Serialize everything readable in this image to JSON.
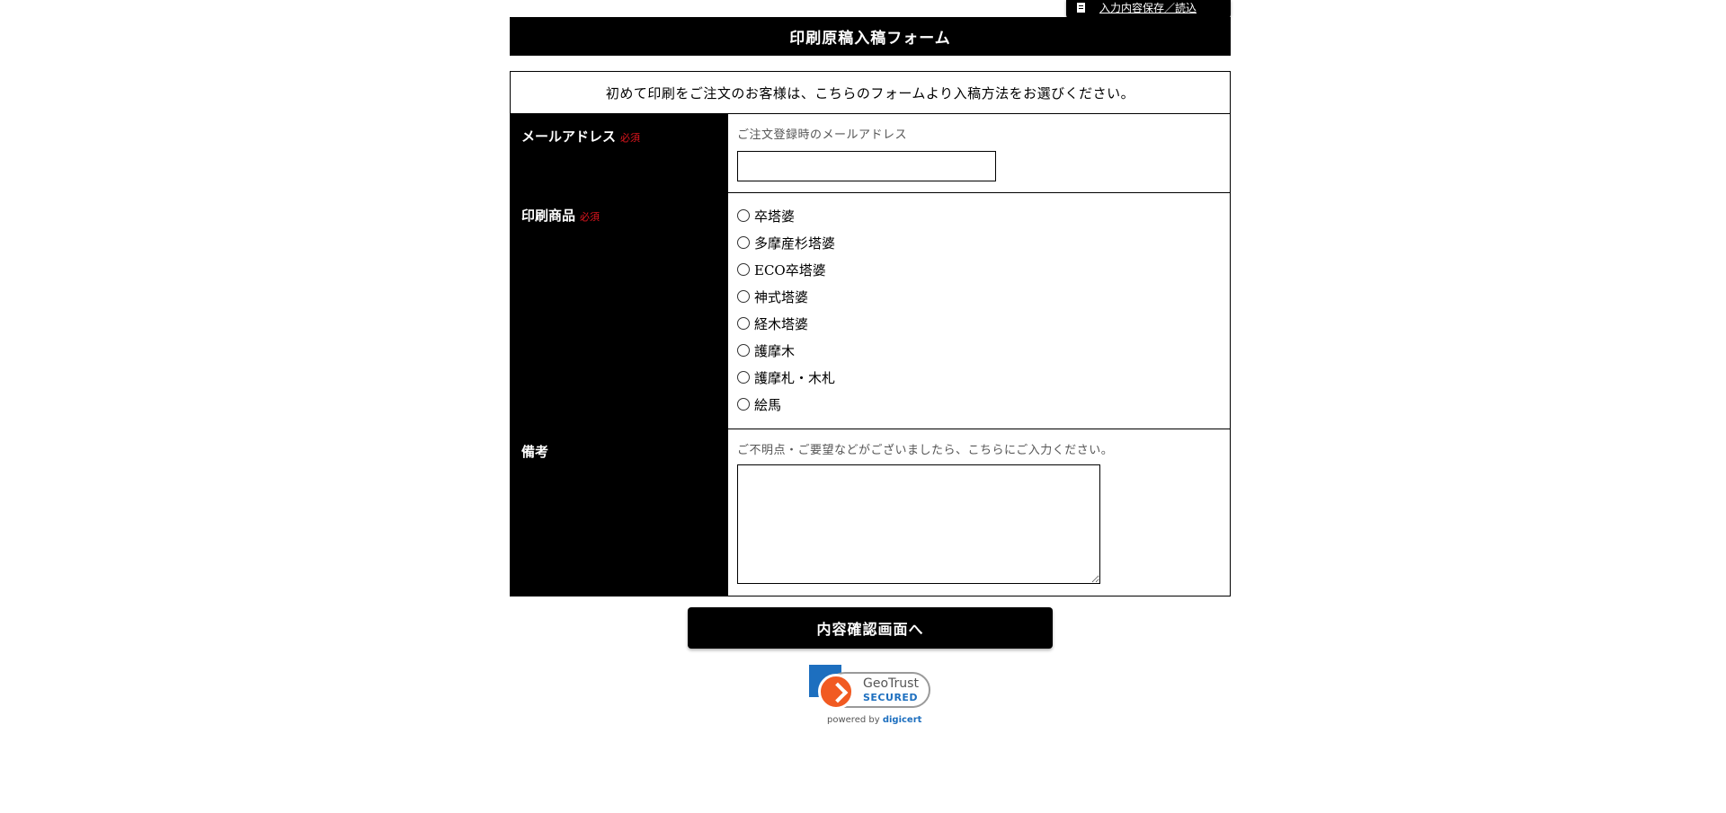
{
  "save_tab": {
    "icon": "document-icon",
    "label": "入力内容保存／読込"
  },
  "header": {
    "title": "印刷原稿入稿フォーム"
  },
  "form": {
    "intro": "初めて印刷をご注文のお客様は、こちらのフォームより入稿方法をお選びください。",
    "email": {
      "label": "メールアドレス",
      "required": "必須",
      "hint": "ご注文登録時のメールアドレス",
      "value": ""
    },
    "product": {
      "label": "印刷商品",
      "required": "必須",
      "options": [
        "卒塔婆",
        "多摩産杉塔婆",
        "ECO卒塔婆",
        "神式塔婆",
        "経木塔婆",
        "護摩木",
        "護摩札・木札",
        "絵馬"
      ]
    },
    "notes": {
      "label": "備考",
      "hint": "ご不明点・ご要望などがございましたら、こちらにご入力ください。",
      "value": ""
    }
  },
  "submit": {
    "label": "内容確認画面へ"
  },
  "trust_badge": {
    "brand": "GeoTrust",
    "secured": "SECURED",
    "powered_by": "powered by",
    "vendor": "digicert"
  },
  "colors": {
    "primary": "#000000",
    "required": "#e0151e",
    "badge_blue": "#1d6fbf",
    "badge_orange": "#f15a22"
  }
}
